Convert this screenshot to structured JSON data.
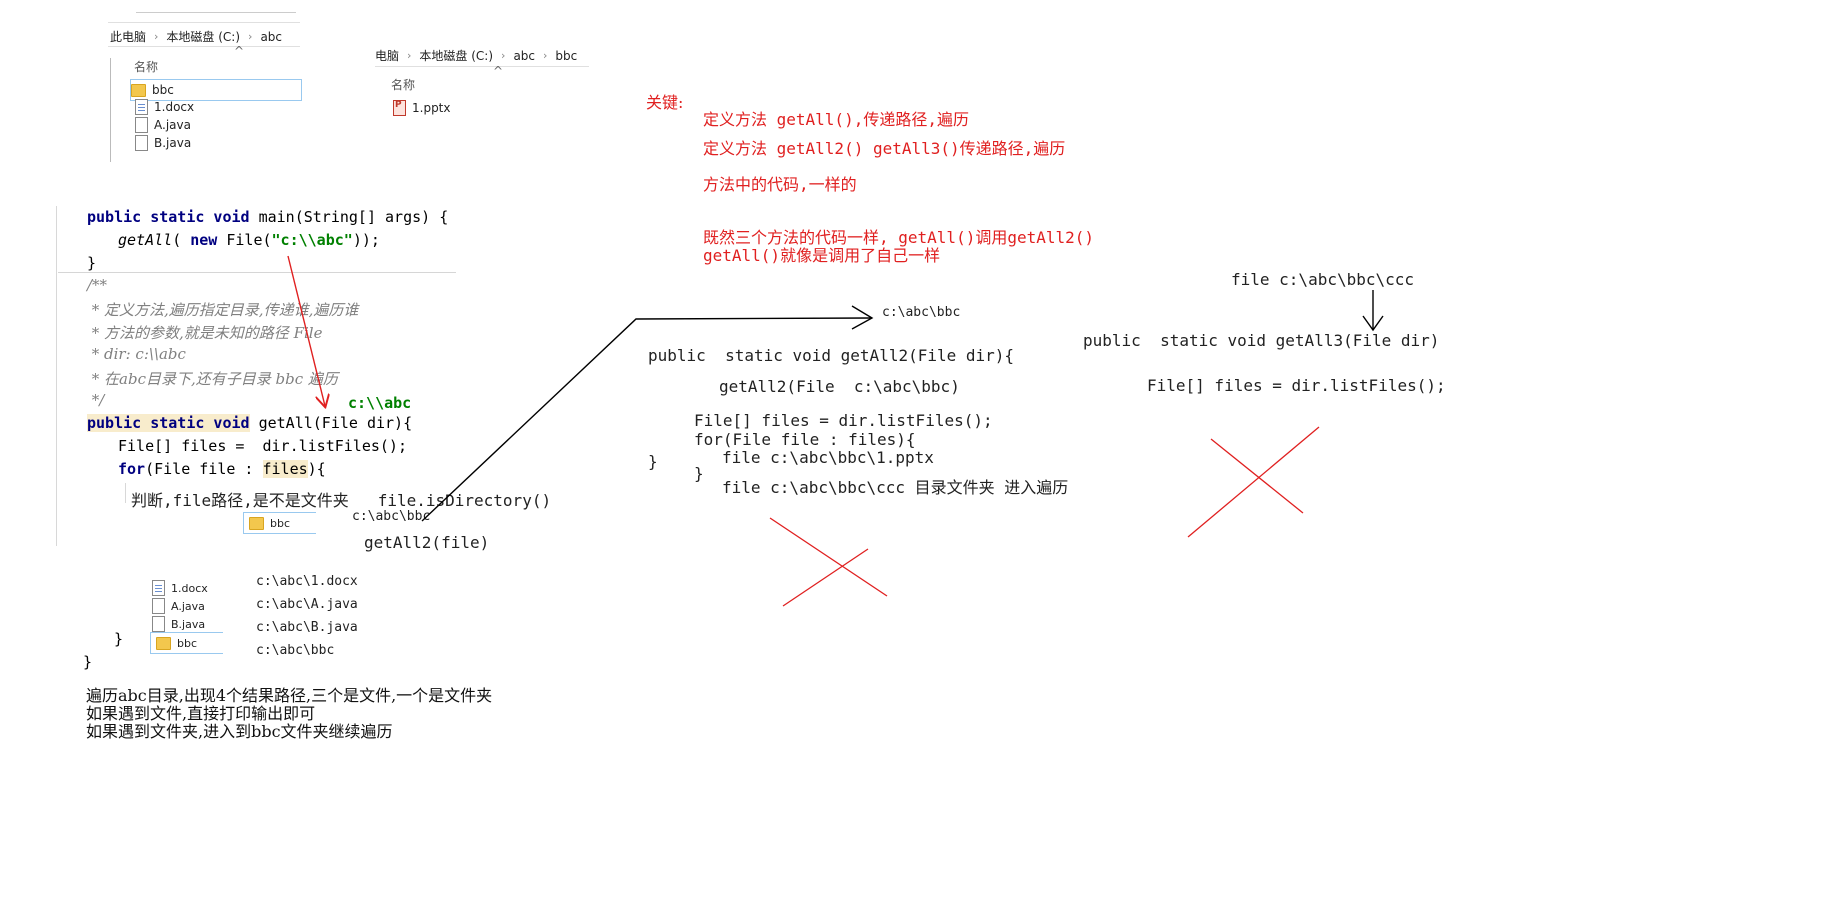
{
  "explorer1": {
    "breadcrumb": [
      "此电脑",
      "本地磁盘 (C:)",
      "abc"
    ],
    "column": "名称",
    "items": [
      {
        "name": "bbc",
        "type": "folder"
      },
      {
        "name": "1.docx",
        "type": "doc"
      },
      {
        "name": "A.java",
        "type": "file"
      },
      {
        "name": "B.java",
        "type": "file"
      }
    ]
  },
  "explorer2": {
    "breadcrumb": [
      "电脑",
      "本地磁盘 (C:)",
      "abc",
      "bbc"
    ],
    "column": "名称",
    "items": [
      {
        "name": "1.pptx",
        "type": "ppt"
      }
    ]
  },
  "notes": {
    "key_label": "关键:",
    "line1": "定义方法 getAll(),传递路径,遍历",
    "line2": "定义方法 getAll2() getAll3()传递路径,遍历",
    "line3": "方法中的代码,一样的",
    "line4": "既然三个方法的代码一样, getAll()调用getAll2()",
    "line5": "getAll()就像是调用了自己一样"
  },
  "code_main": {
    "l1_kw": "public static void",
    "l1_rest": " main(String[] args) {",
    "l2_call": "getAll",
    "l2_mid": "( ",
    "l2_new": "new",
    "l2_type": " File(",
    "l2_str": "\"c:\\\\abc\"",
    "l2_end": "));",
    "l3": "}"
  },
  "comment": {
    "c1": "/**",
    "c2": " * 定义方法,遍历指定目录,传递谁,遍历谁",
    "c3": " * 方法的参数,就是未知的路径 File",
    "c4": " * dir: c:\\\\abc",
    "c5": " * 在abc目录下,还有子目录 bbc 遍历",
    "c6": " */"
  },
  "code_getall": {
    "sig_kw": "public static void",
    "sig_rest": " getAll(File dir){",
    "files_line": "File[] files =  dir.listFiles();",
    "for_kw": "for",
    "for_mid": "(File file : ",
    "for_var": "files",
    "for_end": "){",
    "close1": "}",
    "close2": "}"
  },
  "annotations": {
    "path_abc": "c:\\\\abc",
    "judge": "判断,file路径,是不是文件夹   file.isDirectory()",
    "path_bbc": "c:\\abc\\bbc",
    "call_getall2": "getAll2(file)",
    "mini_bbc": "bbc",
    "mini_items": [
      "1.docx",
      "A.java",
      "B.java",
      "bbc"
    ],
    "paths": [
      "c:\\abc\\1.docx",
      "c:\\abc\\A.java",
      "c:\\abc\\B.java",
      "c:\\abc\\bbc"
    ],
    "summary1": "遍历abc目录,出现4个结果路径,三个是文件,一个是文件夹",
    "summary2": "如果遇到文件,直接打印输出即可",
    "summary3": "如果遇到文件夹,进入到bbc文件夹继续遍历"
  },
  "getall2": {
    "arrow_target": "c:\\abc\\bbc",
    "sig": "public  static void getAll2(File dir){",
    "call": "getAll2(File  c:\\abc\\bbc)",
    "files": "File[] files = dir.listFiles();",
    "for": "for(File file : files){",
    "f1": "file c:\\abc\\bbc\\1.pptx",
    "f2": "file c:\\abc\\bbc\\ccc 目录文件夹 进入遍历",
    "close_inner": "}",
    "close_outer": "}"
  },
  "getall3": {
    "label": "file c:\\abc\\bbc\\ccc",
    "sig": "public  static void getAll3(File dir)",
    "files": "File[] files = dir.listFiles();"
  },
  "colors": {
    "red": "#e02020",
    "keyword": "#000080",
    "string": "#008000",
    "comment": "#808080",
    "highlight": "#f8eccc"
  }
}
